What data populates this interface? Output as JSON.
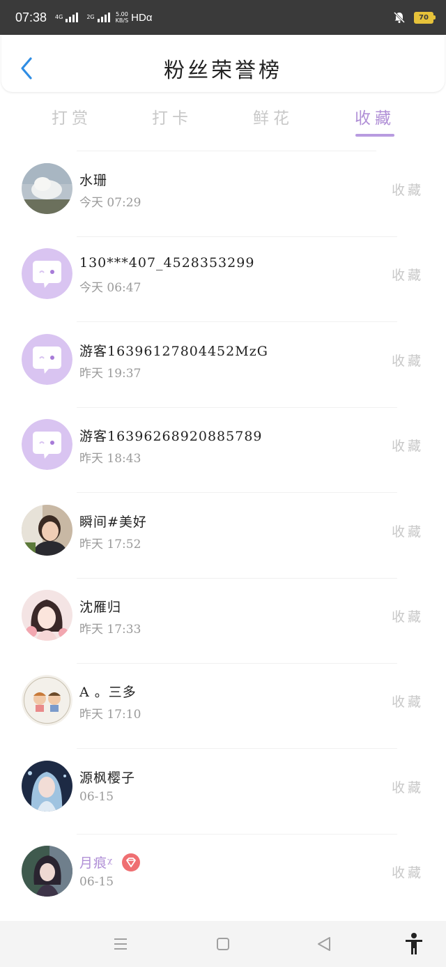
{
  "status_bar": {
    "time": "07:38",
    "signal1_label": "4G",
    "signal2_label": "2G",
    "speed_value": "5.00",
    "speed_unit": "KB/S",
    "hd_label": "HDα",
    "battery": "70"
  },
  "header": {
    "title": "粉丝荣誉榜",
    "back_icon": "chevron-left-icon"
  },
  "tabs": [
    {
      "label": "打赏",
      "active": false
    },
    {
      "label": "打卡",
      "active": false
    },
    {
      "label": "鲜花",
      "active": false
    },
    {
      "label": "收藏",
      "active": true
    }
  ],
  "list": [
    {
      "name": "水珊",
      "time": "今天 07:29",
      "action": "收藏",
      "avatar": "landscape-photo"
    },
    {
      "name": "130***407_4528353299",
      "time": "今天 06:47",
      "action": "收藏",
      "avatar": "default-chat-avatar"
    },
    {
      "name": "游客16396127804452MzG",
      "time": "昨天 19:37",
      "action": "收藏",
      "avatar": "default-chat-avatar"
    },
    {
      "name": "游客16396268920885789",
      "time": "昨天 18:43",
      "action": "收藏",
      "avatar": "default-chat-avatar"
    },
    {
      "name": "瞬间#美好",
      "time": "昨天 17:52",
      "action": "收藏",
      "avatar": "portrait-photo"
    },
    {
      "name": "沈雁归",
      "time": "昨天 17:33",
      "action": "收藏",
      "avatar": "illustrated-girl"
    },
    {
      "name": "A 。三多",
      "time": "昨天 17:10",
      "action": "收藏",
      "avatar": "cartoon-couple"
    },
    {
      "name": "源枫樱子",
      "time": "06-15",
      "action": "收藏",
      "avatar": "illustrated-blue-girl"
    },
    {
      "name": "月痕ᵡ",
      "time": "06-15",
      "action": "收藏",
      "avatar": "anime-character",
      "vip": true
    }
  ],
  "colors": {
    "accent": "#b08fd6",
    "status_bar": "#3a3a3a",
    "inactive_text": "#c8c8c8",
    "vip_badge": "#ef6f72"
  },
  "navbar": {
    "menu_icon": "menu-icon",
    "home_icon": "square-home-icon",
    "back_icon": "triangle-back-icon",
    "accessibility_icon": "accessibility-icon"
  }
}
